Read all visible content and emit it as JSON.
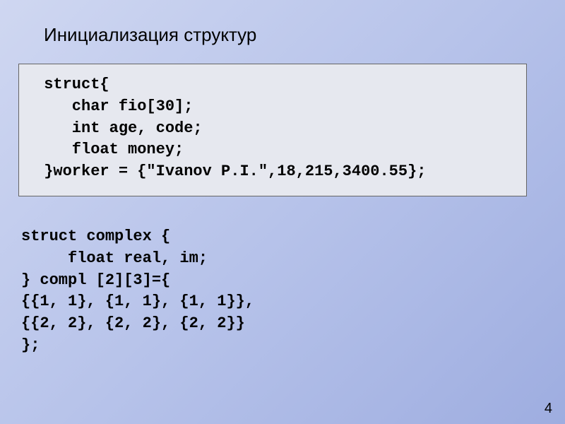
{
  "title": "Инициализация структур",
  "code_box": " struct{\n    char fio[30];\n    int age, code;\n    float money;\n }worker = {\"Ivanov P.I.\",18,215,3400.55};",
  "code_plain": "struct complex {\n     float real, im;\n} compl [2][3]={\n{{1, 1}, {1, 1}, {1, 1}},\n{{2, 2}, {2, 2}, {2, 2}}\n};",
  "page_number": "4"
}
